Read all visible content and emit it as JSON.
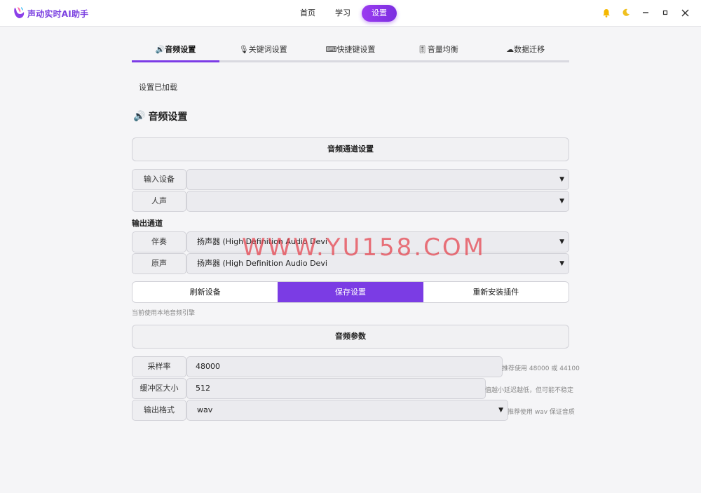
{
  "app": {
    "title": "声动实时AI助手"
  },
  "nav": [
    {
      "label": "首页",
      "active": false
    },
    {
      "label": "学习",
      "active": false
    },
    {
      "label": "设置",
      "active": true
    }
  ],
  "tabs": [
    {
      "icon": "🔊",
      "label": "音频设置",
      "active": true
    },
    {
      "icon": "🎙",
      "label": "关键词设置",
      "active": false
    },
    {
      "icon": "⌨",
      "label": "快捷键设置",
      "active": false
    },
    {
      "icon": "🎚",
      "label": "音量均衡",
      "active": false
    },
    {
      "icon": "☁",
      "label": "数据迁移",
      "active": false
    }
  ],
  "status": "设置已加载",
  "section": {
    "icon": "🔊",
    "title": "音频设置"
  },
  "channel": {
    "header": "音频通道设置",
    "input_device": {
      "label": "输入设备",
      "value": ""
    },
    "voice": {
      "label": "人声",
      "value": ""
    },
    "output_label": "输出通道",
    "accompaniment": {
      "label": "伴奏",
      "value": "扬声器 (High Definition Audio Devi"
    },
    "original": {
      "label": "原声",
      "value": "扬声器 (High Definition Audio Devi"
    }
  },
  "buttons": {
    "refresh": "刷新设备",
    "save": "保存设置",
    "reinstall": "重新安装插件"
  },
  "engine_hint": "当前使用本地音频引擎",
  "params": {
    "header": "音频参数",
    "sample_rate": {
      "label": "采样率",
      "value": "48000",
      "note": "推荐使用 48000 或 44100"
    },
    "buffer_size": {
      "label": "缓冲区大小",
      "value": "512",
      "note": "值越小延迟越低，但可能不稳定"
    },
    "output_format": {
      "label": "输出格式",
      "value": "wav",
      "note": "推荐使用 wav 保证音质"
    }
  },
  "watermark": "WWW.YU158.COM",
  "colors": {
    "accent": "#7b3ce4",
    "bell": "#f5b800",
    "moon": "#f0c020"
  }
}
